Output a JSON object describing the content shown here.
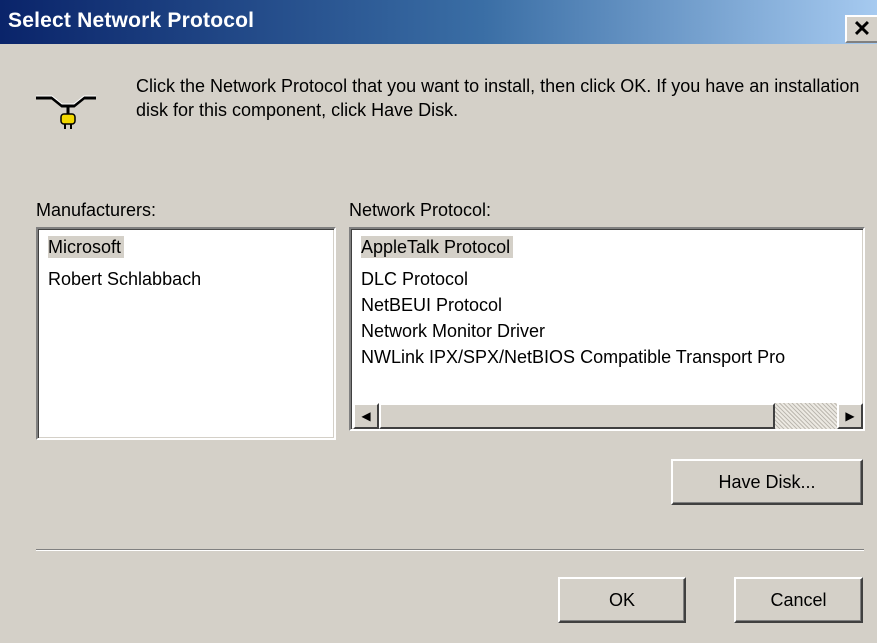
{
  "window": {
    "title": "Select Network Protocol",
    "close_glyph": "✕"
  },
  "instructions": "Click the Network Protocol that you want to install, then click OK. If you have an installation disk for this component, click Have Disk.",
  "icon": "network-protocol-icon",
  "manufacturers": {
    "label": "Manufacturers:",
    "items": [
      "Microsoft",
      "Robert Schlabbach"
    ],
    "selected": "Microsoft"
  },
  "protocols": {
    "label": "Network Protocol:",
    "items": [
      "AppleTalk Protocol",
      "DLC Protocol",
      "NetBEUI Protocol",
      "Network Monitor Driver",
      "NWLink IPX/SPX/NetBIOS Compatible Transport Pro"
    ],
    "selected": "AppleTalk Protocol"
  },
  "buttons": {
    "have_disk": "Have Disk...",
    "ok": "OK",
    "cancel": "Cancel"
  },
  "colors": {
    "title_start": "#0a246a",
    "title_end": "#a6caf0",
    "face": "#d4d0c8",
    "selection": "#d4d0c8"
  }
}
